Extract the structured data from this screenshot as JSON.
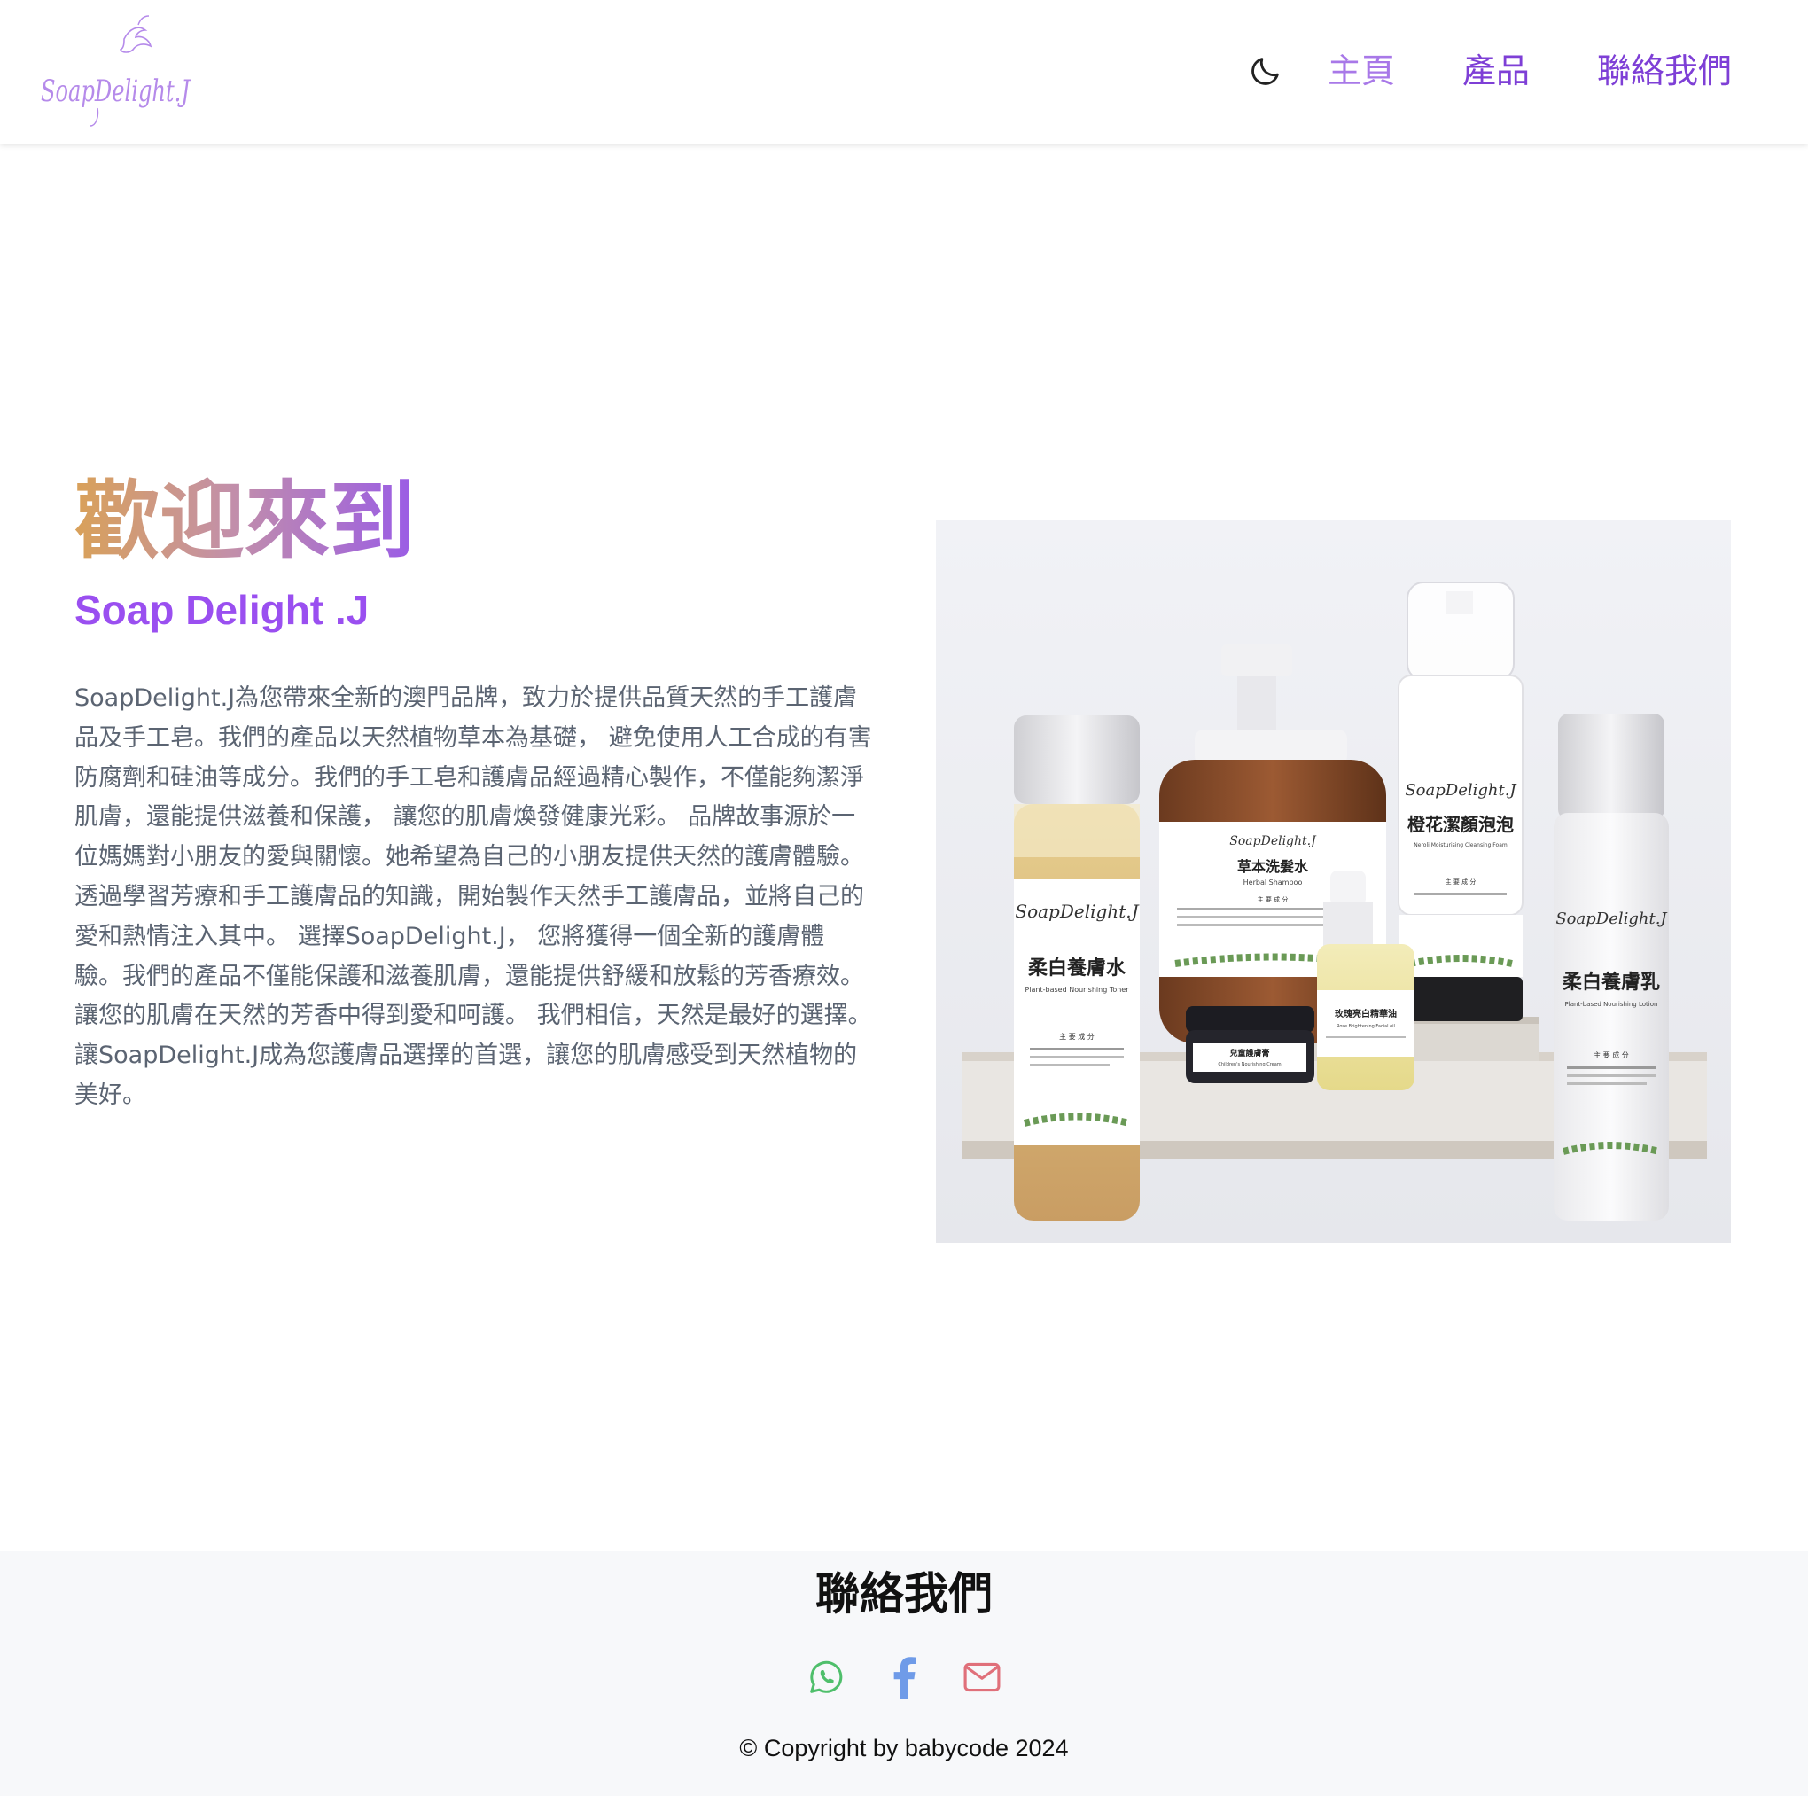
{
  "brand": {
    "logo_text": "SoapDelight.J",
    "logo_color": "#b58aea"
  },
  "nav": {
    "theme_toggle_icon": "moon-icon",
    "items": [
      {
        "label": "主頁",
        "active": true
      },
      {
        "label": "產品",
        "active": false
      },
      {
        "label": "聯絡我們",
        "active": false
      }
    ],
    "accent": "#7e3fd6"
  },
  "hero": {
    "title": "歡迎來到",
    "subtitle": "Soap Delight .J",
    "description": "SoapDelight.J為您帶來全新的澳門品牌，致力於提供品質天然的手工護膚品及手工皂。我們的產品以天然植物草本為基礎， 避免使用人工合成的有害防腐劑和硅油等成分。我們的手工皂和護膚品經過精心製作，不僅能夠潔淨肌膚，還能提供滋養和保護， 讓您的肌膚煥發健康光彩。 品牌故事源於一位媽媽對小朋友的愛與關懷。她希望為自己的小朋友提供天然的護膚體驗。 透過學習芳療和手工護膚品的知識，開始製作天然手工護膚品，並將自己的愛和熱情注入其中。 選擇SoapDelight.J， 您將獲得一個全新的護膚體驗。我們的產品不僅能保護和滋養肌膚，還能提供舒緩和放鬆的芳香療效。讓您的肌膚在天然的芳香中得到愛和呵護。 我們相信，天然是最好的選擇。讓SoapDelight.J成為您護膚品選擇的首選，讓您的肌膚感受到天然植物的美好。",
    "image": {
      "products": [
        {
          "name": "柔白養膚水",
          "en": "Plant-based Nourishing Toner"
        },
        {
          "name": "草本洗髮水",
          "en": "Herbal Shampoo"
        },
        {
          "name": "橙花潔顏泡泡",
          "en": "Neroli Moisturising Cleansing Foam"
        },
        {
          "name": "玫瑰亮白精華油",
          "en": "Rose Brightening Facial oil"
        },
        {
          "name": "兒童護膚膏",
          "en": "Children's Nourishing Cream"
        },
        {
          "name": "柔白養膚乳",
          "en": "Plant-based Nourishing Lotion"
        }
      ],
      "label_heading": "主 要 成 分",
      "brand_script": "SoapDelight.J"
    }
  },
  "footer": {
    "title": "聯絡我們",
    "icons": [
      "whatsapp-icon",
      "facebook-icon",
      "mail-icon"
    ],
    "icon_colors": {
      "whatsapp": "#4fbf6b",
      "facebook": "#6f9be8",
      "mail": "#e0707a"
    },
    "copyright": "© Copyright by babycode 2024"
  }
}
